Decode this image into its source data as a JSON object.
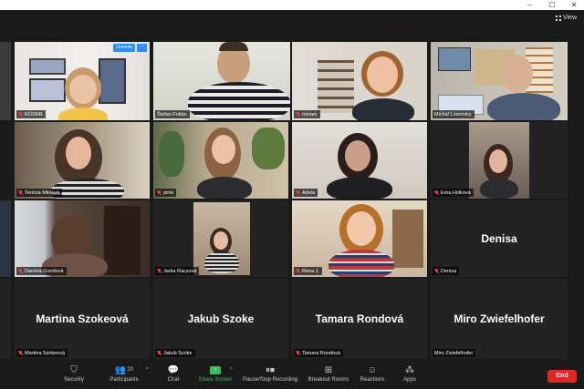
{
  "window": {
    "controls": [
      "–",
      "☐",
      "✕"
    ]
  },
  "view": {
    "label": "View"
  },
  "row1": [
    {
      "name": "KOSNR",
      "muted": true,
      "unmute_label": "Unmute",
      "more_label": "···"
    },
    {
      "name": "Štefan Foltán",
      "muted": false
    },
    {
      "name": "miriam",
      "muted": true
    },
    {
      "name": "Michal Losonsky",
      "muted": true
    }
  ],
  "row2": [
    {
      "name": "Terézia Miklová",
      "muted": true
    },
    {
      "name": "pinki",
      "muted": true
    },
    {
      "name": "Adela",
      "muted": true
    },
    {
      "name": "Ema Holková",
      "muted": true
    }
  ],
  "row3": [
    {
      "name": "Daniela Gundová",
      "muted": true
    },
    {
      "name": "Jarka Ráczová",
      "muted": true
    },
    {
      "name": "Rena J.",
      "muted": true
    },
    {
      "name": "Denisa",
      "muted": true,
      "big": "Denisa"
    }
  ],
  "row4": [
    {
      "name": "Martina Szokeová",
      "muted": true,
      "big": "Martina Szokeová"
    },
    {
      "name": "Jakub Szoke",
      "muted": true,
      "big": "Jakub Szoke"
    },
    {
      "name": "Tamara Rondová",
      "muted": true,
      "big": "Tamara Rondová"
    },
    {
      "name": "Miro Zwiefelhofer",
      "muted": false,
      "big": "Miro Zwiefelhofer"
    }
  ],
  "toolbar": {
    "security": "Security",
    "participants": "Participants",
    "participants_count": "20",
    "chat": "Chat",
    "share": "Share Screen",
    "record": "Pause/Stop Recording",
    "breakout": "Breakout Rooms",
    "reactions": "Reactions",
    "apps": "Apps",
    "end": "End"
  },
  "colors": {
    "active_speaker": "#d6e23a",
    "share_green": "#3bbc5c",
    "end_red": "#e02828",
    "unmute_blue": "#2d8cff"
  }
}
